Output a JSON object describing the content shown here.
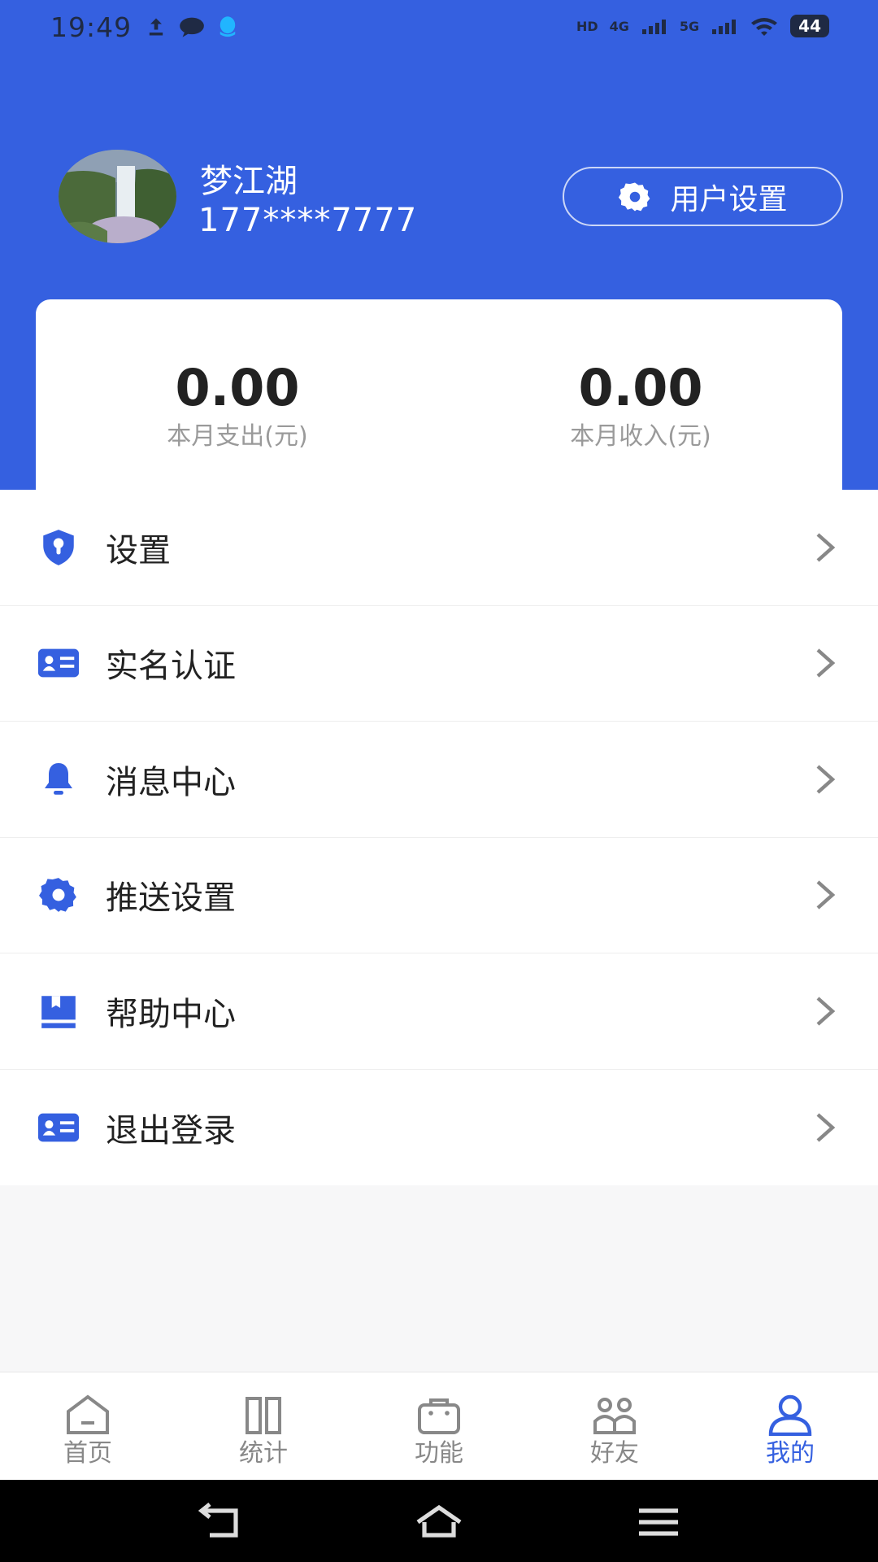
{
  "status_bar": {
    "time": "19:49",
    "network_badges": [
      "HD",
      "4G",
      "5G"
    ],
    "battery": "44"
  },
  "profile": {
    "name": "梦江湖",
    "phone": "177****7777",
    "settings_button": "用户设置"
  },
  "stats": [
    {
      "value": "0.00",
      "label": "本月支出(元)"
    },
    {
      "value": "0.00",
      "label": "本月收入(元)"
    }
  ],
  "menu": [
    {
      "label": "设置",
      "icon": "shield-icon"
    },
    {
      "label": "实名认证",
      "icon": "id-card-icon"
    },
    {
      "label": "消息中心",
      "icon": "bell-icon"
    },
    {
      "label": "推送设置",
      "icon": "gear-icon"
    },
    {
      "label": "帮助中心",
      "icon": "book-icon"
    },
    {
      "label": "退出登录",
      "icon": "id-card-icon"
    }
  ],
  "tabs": [
    {
      "label": "首页",
      "icon": "home-icon",
      "active": false
    },
    {
      "label": "统计",
      "icon": "columns-icon",
      "active": false
    },
    {
      "label": "功能",
      "icon": "bag-icon",
      "active": false
    },
    {
      "label": "好友",
      "icon": "friends-icon",
      "active": false
    },
    {
      "label": "我的",
      "icon": "user-icon",
      "active": true
    }
  ],
  "colors": {
    "primary": "#3560e0",
    "text": "#222222",
    "muted": "#9a9a9a"
  }
}
